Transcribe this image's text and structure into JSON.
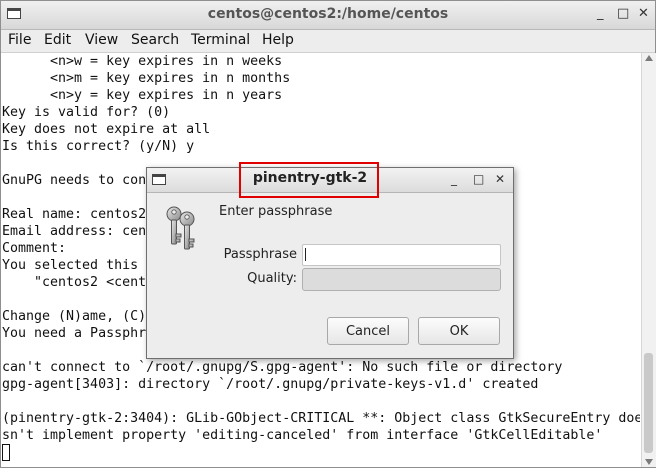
{
  "terminal": {
    "title": "centos@centos2:/home/centos",
    "window_controls": {
      "minimize": "_",
      "maximize": "□",
      "close": "✕"
    },
    "menu": [
      "File",
      "Edit",
      "View",
      "Search",
      "Terminal",
      "Help"
    ],
    "lines": [
      "      <n>w = key expires in n weeks",
      "      <n>m = key expires in n months",
      "      <n>y = key expires in n years",
      "Key is valid for? (0)",
      "Key does not expire at all",
      "Is this correct? (y/N) y",
      "",
      "GnuPG needs to con",
      "",
      "Real name: centos2",
      "Email address: cen",
      "Comment:",
      "You selected this",
      "    \"centos2 <cent",
      "",
      "Change (N)ame, (C)",
      "You need a Passphr",
      "",
      "can't connect to `/root/.gnupg/S.gpg-agent': No such file or directory",
      "gpg-agent[3403]: directory `/root/.gnupg/private-keys-v1.d' created",
      "",
      "(pinentry-gtk-2:3404): GLib-GObject-CRITICAL **: Object class GtkSecureEntry doe",
      "sn't implement property 'editing-canceled' from interface 'GtkCellEditable'"
    ]
  },
  "dialog": {
    "title": "pinentry-gtk-2",
    "window_controls": {
      "minimize": "_",
      "maximize": "□",
      "close": "✕"
    },
    "prompt": "Enter passphrase",
    "passphrase_label": "Passphrase",
    "passphrase_value": "",
    "quality_label": "Quality:",
    "quality_fraction": 0,
    "cancel_label": "Cancel",
    "ok_label": "OK",
    "icon": "keys-icon",
    "highlight_color": "#e00000"
  }
}
